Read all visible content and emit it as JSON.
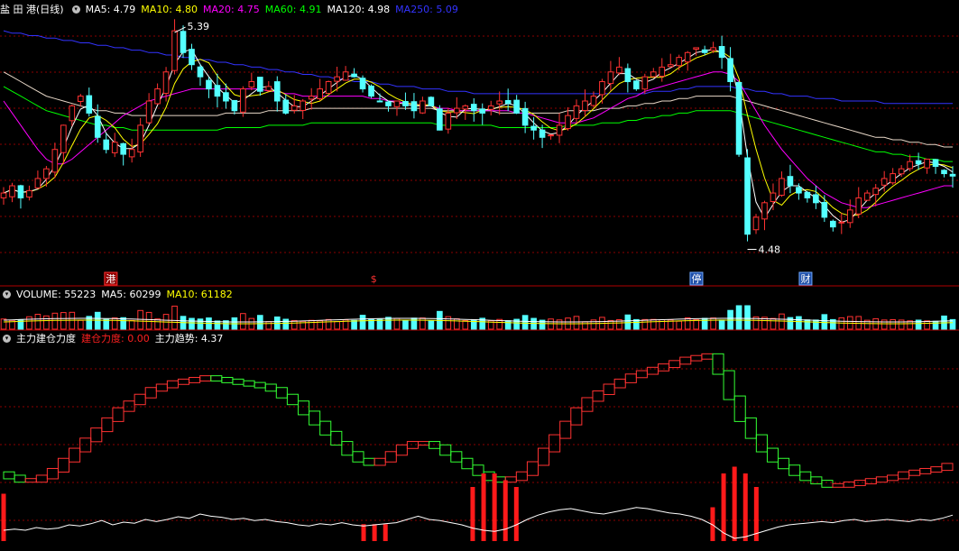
{
  "price_panel": {
    "stock_name": "盐 田 港(日线)",
    "indicators": [
      {
        "label": "MA5: 4.79",
        "color": "#ffffff"
      },
      {
        "label": "MA10: 4.80",
        "color": "#ffff00"
      },
      {
        "label": "MA20: 4.75",
        "color": "#ff00ff"
      },
      {
        "label": "MA60: 4.91",
        "color": "#00ff00"
      },
      {
        "label": "MA120: 4.98",
        "color": "#ffffff"
      },
      {
        "label": "MA250: 5.09",
        "color": "#3333ff"
      }
    ],
    "high_label": "5.39",
    "low_label": "4.48",
    "event_markers": [
      {
        "text": "港",
        "style": "red-box"
      },
      {
        "text": "$",
        "style": "red-text"
      },
      {
        "text": "停",
        "style": "blue-box"
      },
      {
        "text": "财",
        "style": "blue-box"
      }
    ]
  },
  "volume_panel": {
    "indicators": [
      {
        "label": "VOLUME: 55223",
        "color": "#ffffff"
      },
      {
        "label": "MA5: 60299",
        "color": "#ffffff"
      },
      {
        "label": "MA10: 61182",
        "color": "#ffff00"
      }
    ]
  },
  "indicator_panel": {
    "indicators": [
      {
        "label": "主力建仓力度",
        "color": "#ffffff"
      },
      {
        "label": "建仓力度: 0.00",
        "color": "#ff2020"
      },
      {
        "label": "主力趋势: 4.37",
        "color": "#ffffff"
      }
    ]
  },
  "colors": {
    "up": "#ff3232",
    "down": "#54ffff",
    "grid": "#8b0000",
    "ma250": "#3333ff",
    "ma60": "#00ff00",
    "ma20": "#ff00ff",
    "ma10": "#ffff00"
  },
  "chart_data": [
    {
      "type": "candlestick",
      "title": "盐 田 港(日线)",
      "high_marker": 5.39,
      "low_marker": 4.48,
      "ylim": [
        4.4,
        5.45
      ],
      "ma_latest": {
        "MA5": 4.79,
        "MA10": 4.8,
        "MA20": 4.75,
        "MA60": 4.91,
        "MA120": 4.98,
        "MA250": 5.09
      },
      "close": [
        4.72,
        4.75,
        4.7,
        4.73,
        4.78,
        4.82,
        4.9,
        5.0,
        5.08,
        5.12,
        5.05,
        4.95,
        4.9,
        4.93,
        4.88,
        4.9,
        5.0,
        5.1,
        5.15,
        5.22,
        5.39,
        5.3,
        5.25,
        5.2,
        5.15,
        5.12,
        5.1,
        5.06,
        5.15,
        5.18,
        5.14,
        5.16,
        5.1,
        5.05,
        5.08,
        5.1,
        5.12,
        5.15,
        5.18,
        5.2,
        5.22,
        5.2,
        5.15,
        5.12,
        5.1,
        5.08,
        5.1,
        5.08,
        5.06,
        5.1,
        5.08,
        4.98,
        5.05,
        5.07,
        5.08,
        5.06,
        5.05,
        5.08,
        5.1,
        5.09,
        5.05,
        5.0,
        4.98,
        4.95,
        4.96,
        5.0,
        5.04,
        5.08,
        5.1,
        5.12,
        5.18,
        5.22,
        5.24,
        5.18,
        5.15,
        5.2,
        5.22,
        5.24,
        5.25,
        5.28,
        5.3,
        5.32,
        5.3,
        5.32,
        5.28,
        5.18,
        4.88,
        4.55,
        4.62,
        4.68,
        4.72,
        4.78,
        4.75,
        4.72,
        4.7,
        4.68,
        4.62,
        4.58,
        4.6,
        4.65,
        4.7,
        4.72,
        4.74,
        4.78,
        4.8,
        4.82,
        4.85,
        4.84,
        4.86,
        4.83,
        4.8,
        4.79
      ],
      "MA250": [
        5.39,
        5.38,
        5.38,
        5.37,
        5.37,
        5.36,
        5.36,
        5.35,
        5.35,
        5.34,
        5.34,
        5.33,
        5.33,
        5.32,
        5.32,
        5.31,
        5.31,
        5.3,
        5.3,
        5.29,
        5.29,
        5.28,
        5.28,
        5.27,
        5.27,
        5.26,
        5.26,
        5.25,
        5.25,
        5.24,
        5.24,
        5.23,
        5.23,
        5.22,
        5.22,
        5.21,
        5.21,
        5.2,
        5.2,
        5.19,
        5.19,
        5.18,
        5.18,
        5.18,
        5.17,
        5.17,
        5.16,
        5.16,
        5.16,
        5.15,
        5.15,
        5.15,
        5.14,
        5.14,
        5.14,
        5.13,
        5.13,
        5.13,
        5.13,
        5.13,
        5.13,
        5.13,
        5.13,
        5.13,
        5.13,
        5.13,
        5.13,
        5.13,
        5.13,
        5.13,
        5.13,
        5.13,
        5.13,
        5.13,
        5.13,
        5.13,
        5.14,
        5.14,
        5.14,
        5.15,
        5.15,
        5.16,
        5.16,
        5.16,
        5.16,
        5.16,
        5.15,
        5.15,
        5.14,
        5.14,
        5.13,
        5.13,
        5.12,
        5.12,
        5.12,
        5.11,
        5.11,
        5.11,
        5.1,
        5.1,
        5.1,
        5.1,
        5.1,
        5.09,
        5.09,
        5.09,
        5.09,
        5.09,
        5.09,
        5.09,
        5.09,
        5.09
      ],
      "MA60": [
        5.22,
        5.2,
        5.18,
        5.16,
        5.14,
        5.12,
        5.11,
        5.1,
        5.09,
        5.08,
        5.07,
        5.06,
        5.06,
        5.05,
        5.05,
        5.04,
        5.04,
        5.04,
        5.04,
        5.04,
        5.04,
        5.04,
        5.04,
        5.04,
        5.04,
        5.04,
        5.05,
        5.05,
        5.05,
        5.05,
        5.05,
        5.06,
        5.06,
        5.06,
        5.06,
        5.06,
        5.07,
        5.07,
        5.07,
        5.07,
        5.07,
        5.07,
        5.07,
        5.07,
        5.07,
        5.07,
        5.07,
        5.07,
        5.07,
        5.07,
        5.07,
        5.06,
        5.06,
        5.06,
        5.06,
        5.06,
        5.06,
        5.06,
        5.05,
        5.05,
        5.05,
        5.05,
        5.05,
        5.05,
        5.05,
        5.05,
        5.06,
        5.06,
        5.06,
        5.06,
        5.07,
        5.07,
        5.07,
        5.08,
        5.08,
        5.09,
        5.09,
        5.1,
        5.1,
        5.11,
        5.11,
        5.12,
        5.12,
        5.12,
        5.12,
        5.12,
        5.11,
        5.1,
        5.09,
        5.08,
        5.07,
        5.06,
        5.05,
        5.04,
        5.03,
        5.02,
        5.01,
        5.0,
        4.99,
        4.98,
        4.97,
        4.96,
        4.95,
        4.95,
        4.94,
        4.94,
        4.93,
        4.93,
        4.92,
        4.92,
        4.91,
        4.91
      ],
      "MA20": [
        5.1,
        5.05,
        5.0,
        4.95,
        4.9,
        4.86,
        4.84,
        4.84,
        4.86,
        4.89,
        4.92,
        4.95,
        4.98,
        5.01,
        5.04,
        5.06,
        5.08,
        5.1,
        5.11,
        5.12,
        5.13,
        5.14,
        5.15,
        5.15,
        5.15,
        5.15,
        5.15,
        5.15,
        5.15,
        5.15,
        5.15,
        5.14,
        5.14,
        5.13,
        5.13,
        5.12,
        5.12,
        5.12,
        5.12,
        5.12,
        5.12,
        5.12,
        5.12,
        5.11,
        5.11,
        5.1,
        5.1,
        5.09,
        5.09,
        5.08,
        5.08,
        5.07,
        5.07,
        5.06,
        5.06,
        5.06,
        5.06,
        5.06,
        5.06,
        5.06,
        5.05,
        5.05,
        5.04,
        5.03,
        5.02,
        5.01,
        5.01,
        5.01,
        5.02,
        5.03,
        5.05,
        5.07,
        5.09,
        5.11,
        5.12,
        5.14,
        5.15,
        5.16,
        5.17,
        5.18,
        5.19,
        5.2,
        5.21,
        5.22,
        5.22,
        5.21,
        5.18,
        5.12,
        5.06,
        5.0,
        4.95,
        4.9,
        4.86,
        4.82,
        4.78,
        4.75,
        4.72,
        4.7,
        4.68,
        4.67,
        4.66,
        4.66,
        4.67,
        4.68,
        4.69,
        4.7,
        4.71,
        4.72,
        4.73,
        4.74,
        4.75,
        4.75
      ]
    },
    {
      "type": "bar",
      "title": "VOLUME",
      "latest": {
        "VOLUME": 55223,
        "MA5": 60299,
        "MA10": 61182
      }
    },
    {
      "type": "bar",
      "title": "主力建仓力度",
      "latest": {
        "建仓力度": 0.0,
        "主力趋势": 4.37
      },
      "trend": [
        0.4,
        0.38,
        0.36,
        0.36,
        0.38,
        0.42,
        0.48,
        0.54,
        0.6,
        0.66,
        0.72,
        0.78,
        0.82,
        0.86,
        0.9,
        0.92,
        0.94,
        0.95,
        0.96,
        0.97,
        0.96,
        0.95,
        0.94,
        0.93,
        0.92,
        0.9,
        0.86,
        0.82,
        0.76,
        0.7,
        0.64,
        0.58,
        0.52,
        0.48,
        0.46,
        0.48,
        0.52,
        0.56,
        0.58,
        0.58,
        0.56,
        0.52,
        0.48,
        0.44,
        0.4,
        0.37,
        0.36,
        0.37,
        0.4,
        0.46,
        0.54,
        0.62,
        0.7,
        0.78,
        0.84,
        0.88,
        0.92,
        0.95,
        0.98,
        1.0,
        1.02,
        1.04,
        1.06,
        1.08,
        1.09,
        1.1,
        1.0,
        0.85,
        0.72,
        0.62,
        0.54,
        0.48,
        0.44,
        0.4,
        0.37,
        0.35,
        0.33,
        0.33,
        0.34,
        0.35,
        0.36,
        0.37,
        0.38,
        0.4,
        0.41,
        0.42,
        0.43,
        0.45
      ],
      "force": [
        0.7,
        0,
        0,
        0,
        0,
        0,
        0,
        0,
        0,
        0,
        0,
        0,
        0,
        0,
        0,
        0,
        0,
        0,
        0,
        0,
        0,
        0,
        0,
        0,
        0,
        0,
        0,
        0,
        0,
        0,
        0,
        0,
        0,
        0.25,
        0.25,
        0.25,
        0,
        0,
        0,
        0,
        0,
        0,
        0,
        0.8,
        1.0,
        1.0,
        0.9,
        0.8,
        0,
        0,
        0,
        0,
        0,
        0,
        0,
        0,
        0,
        0,
        0,
        0,
        0,
        0,
        0,
        0,
        0,
        0.5,
        1.0,
        1.1,
        1.0,
        0.8,
        0,
        0,
        0,
        0,
        0,
        0,
        0,
        0,
        0,
        0,
        0,
        0,
        0,
        0,
        0,
        0,
        0,
        0
      ],
      "bottom_line": [
        0.2,
        0.22,
        0.2,
        0.25,
        0.22,
        0.24,
        0.3,
        0.28,
        0.32,
        0.38,
        0.3,
        0.35,
        0.33,
        0.4,
        0.36,
        0.4,
        0.45,
        0.42,
        0.5,
        0.46,
        0.44,
        0.4,
        0.42,
        0.38,
        0.4,
        0.36,
        0.34,
        0.3,
        0.28,
        0.32,
        0.3,
        0.34,
        0.3,
        0.28,
        0.3,
        0.32,
        0.34,
        0.4,
        0.46,
        0.4,
        0.38,
        0.34,
        0.3,
        0.24,
        0.2,
        0.18,
        0.22,
        0.3,
        0.4,
        0.48,
        0.54,
        0.58,
        0.6,
        0.56,
        0.52,
        0.5,
        0.54,
        0.58,
        0.62,
        0.6,
        0.56,
        0.52,
        0.5,
        0.46,
        0.4,
        0.3,
        0.15,
        0.05,
        0.08,
        0.14,
        0.2,
        0.26,
        0.3,
        0.32,
        0.34,
        0.36,
        0.34,
        0.38,
        0.4,
        0.36,
        0.38,
        0.4,
        0.38,
        0.36,
        0.4,
        0.38,
        0.42,
        0.48
      ]
    }
  ]
}
